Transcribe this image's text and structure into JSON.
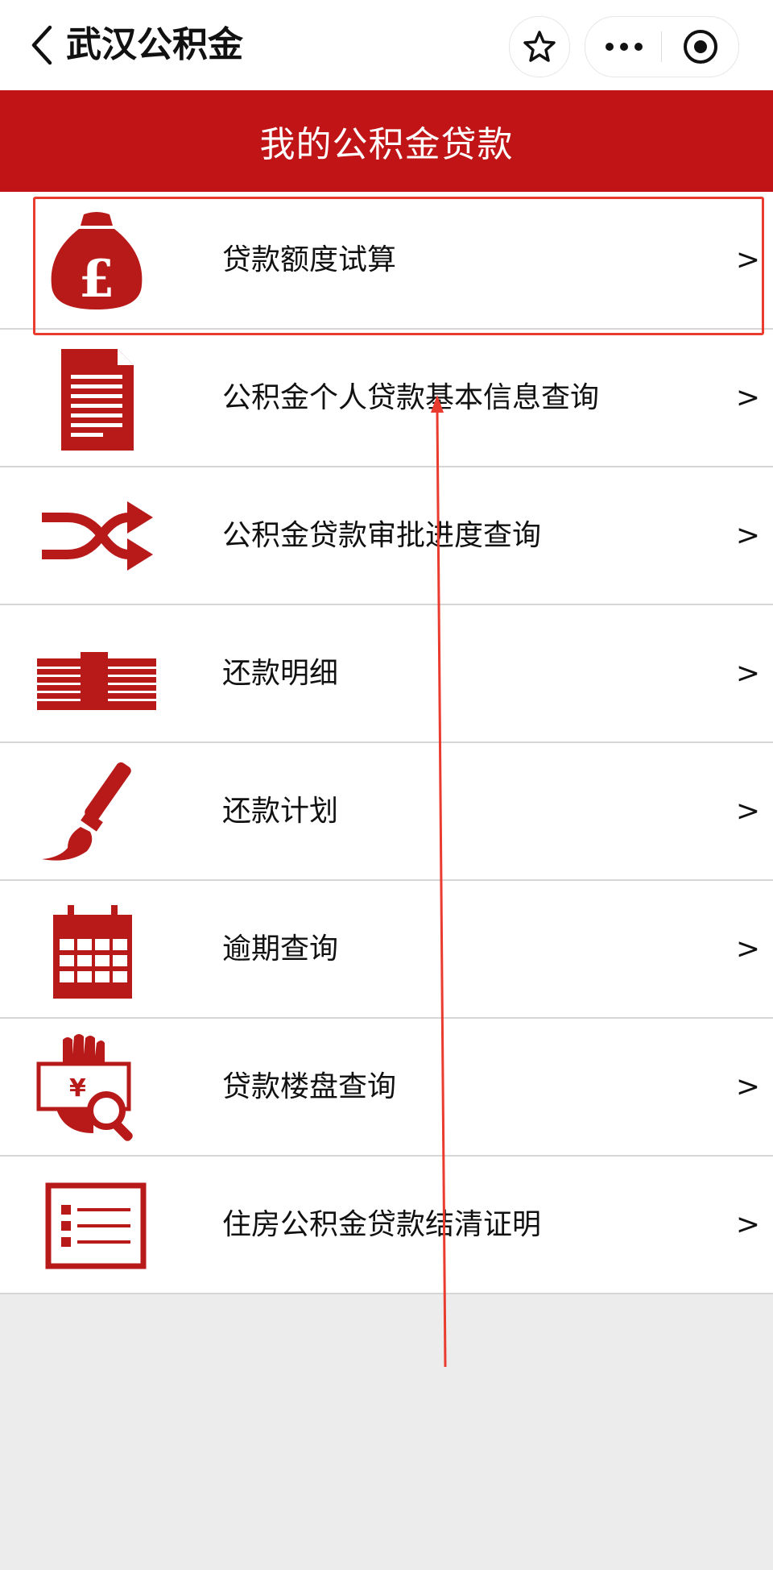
{
  "header": {
    "title": "武汉公积金",
    "back_icon": "back-icon",
    "star_icon": "star-icon",
    "more_icon": "more-icon",
    "close_icon": "target-icon"
  },
  "banner": {
    "title": "我的公积金贷款"
  },
  "menu": {
    "items": [
      {
        "label": "贷款额度试算",
        "icon": "money-bag-icon",
        "chevron": ">"
      },
      {
        "label": "公积金个人贷款基本信息查询",
        "icon": "document-icon",
        "chevron": ">"
      },
      {
        "label": "公积金贷款审批进度查询",
        "icon": "shuffle-icon",
        "chevron": ">"
      },
      {
        "label": "还款明细",
        "icon": "cash-stack-icon",
        "chevron": ">"
      },
      {
        "label": "还款计划",
        "icon": "brush-icon",
        "chevron": ">"
      },
      {
        "label": "逾期查询",
        "icon": "calendar-icon",
        "chevron": ">"
      },
      {
        "label": "贷款楼盘查询",
        "icon": "search-money-icon",
        "chevron": ">"
      },
      {
        "label": "住房公积金贷款结清证明",
        "icon": "list-icon",
        "chevron": ">"
      }
    ]
  },
  "colors": {
    "brand_red": "#c01416",
    "annotation_red": "#ea3b2f",
    "background": "#ececec"
  }
}
